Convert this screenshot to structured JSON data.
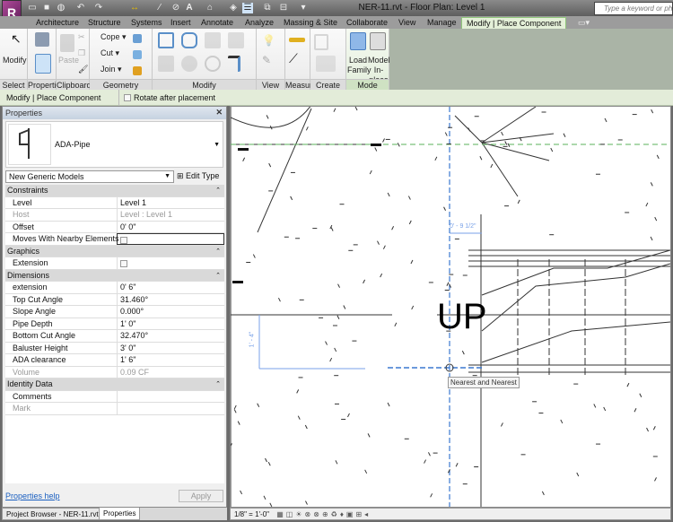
{
  "window": {
    "title": "NER-11.rvt - Floor Plan: Level 1",
    "search_placeholder": "Type a keyword or phrase"
  },
  "tabs": [
    "Architecture",
    "Structure",
    "Systems",
    "Insert",
    "Annotate",
    "Analyze",
    "Massing & Site",
    "Collaborate",
    "View",
    "Manage",
    "Modify | Place Component"
  ],
  "active_tab": "Modify | Place Component",
  "ribbon": {
    "panels": [
      "Select ▾",
      "Properties",
      "Clipboard",
      "Geometry",
      "Modify",
      "View",
      "Measure",
      "Create",
      "Mode"
    ],
    "buttons": {
      "modify": "Modify",
      "paste": "Paste",
      "cope": "Cope",
      "cut": "Cut",
      "join": "Join",
      "load_family_1": "Load",
      "load_family_2": "Family",
      "model_inplace_1": "Model",
      "model_inplace_2": "In-place"
    }
  },
  "options_bar": {
    "context": "Modify | Place Component",
    "rotate_label": "Rotate after placement",
    "rotate_checked": false
  },
  "properties": {
    "title": "Properties",
    "close": "✕",
    "type_name": "ADA-Pipe",
    "type_selector": "New Generic Models",
    "edit_type": "Edit Type",
    "groups": [
      {
        "name": "Constraints",
        "rows": [
          {
            "k": "Level",
            "v": "Level 1"
          },
          {
            "k": "Host",
            "v": "Level : Level 1",
            "disabled": true
          },
          {
            "k": "Offset",
            "v": "0'  0\""
          },
          {
            "k": "Moves With Nearby Elements",
            "v": "",
            "checkbox": true
          }
        ]
      },
      {
        "name": "Graphics",
        "rows": [
          {
            "k": "Extension",
            "v": "",
            "checkbox": true
          }
        ]
      },
      {
        "name": "Dimensions",
        "rows": [
          {
            "k": "extension",
            "v": "0'  6\""
          },
          {
            "k": "Top Cut Angle",
            "v": "31.460°"
          },
          {
            "k": "Slope Angle",
            "v": "0.000°"
          },
          {
            "k": "Pipe Depth",
            "v": "1'  0\""
          },
          {
            "k": "Bottom Cut Angle",
            "v": "32.470°"
          },
          {
            "k": "Baluster Height",
            "v": "3'  0\""
          },
          {
            "k": "ADA clearance",
            "v": "1'  6\""
          },
          {
            "k": "Volume",
            "v": "0.09 CF",
            "disabled": true
          }
        ]
      },
      {
        "name": "Identity Data",
        "rows": [
          {
            "k": "Comments",
            "v": ""
          },
          {
            "k": "Mark",
            "v": "",
            "disabled": true
          }
        ]
      }
    ],
    "help_link": "Properties help",
    "apply": "Apply"
  },
  "bottom_tabs": [
    "Project Browser - NER-11.rvt",
    "Properties"
  ],
  "canvas": {
    "stair_label": "UP",
    "dim_horizontal": "0' - 9 1/2\"",
    "dim_vertical": "1' - 4\"",
    "snap_tooltip": "Nearest and Nearest"
  },
  "status": {
    "scale": "1/8\" = 1'-0\""
  }
}
